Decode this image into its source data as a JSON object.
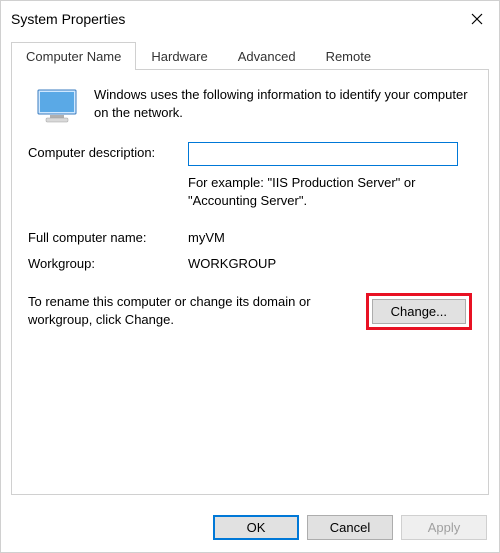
{
  "window": {
    "title": "System Properties"
  },
  "tabs": {
    "computer_name": "Computer Name",
    "hardware": "Hardware",
    "advanced": "Advanced",
    "remote": "Remote"
  },
  "intro": "Windows uses the following information to identify your computer on the network.",
  "desc": {
    "label": "Computer description:",
    "value": "",
    "example": "For example: \"IIS Production Server\" or \"Accounting Server\"."
  },
  "full_name": {
    "label": "Full computer name:",
    "value": "myVM"
  },
  "workgroup": {
    "label": "Workgroup:",
    "value": "WORKGROUP"
  },
  "rename": {
    "text": "To rename this computer or change its domain or workgroup, click Change.",
    "button": "Change..."
  },
  "footer": {
    "ok": "OK",
    "cancel": "Cancel",
    "apply": "Apply"
  }
}
